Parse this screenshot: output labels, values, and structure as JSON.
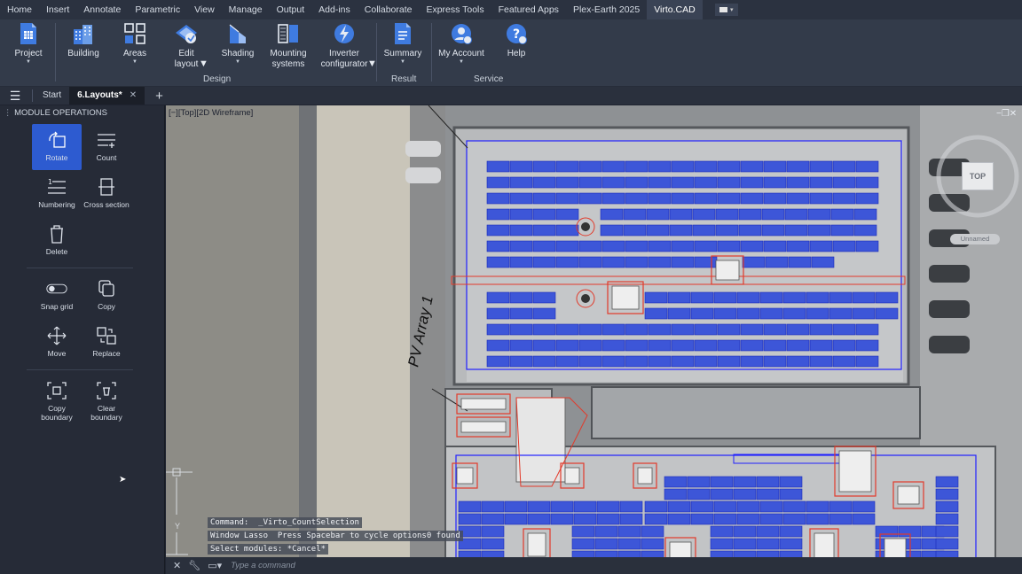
{
  "menubar": {
    "tabs": [
      "Home",
      "Insert",
      "Annotate",
      "Parametric",
      "View",
      "Manage",
      "Output",
      "Add-ins",
      "Collaborate",
      "Express Tools",
      "Featured Apps",
      "Plex-Earth 2025",
      "Virto.CAD"
    ],
    "active": "Virto.CAD"
  },
  "ribbon": {
    "buttons": {
      "project": "Project",
      "building": "Building",
      "areas": "Areas",
      "edit_layout": "Edit\nlayout",
      "shading": "Shading",
      "mounting": "Mounting\nsystems",
      "inverter": "Inverter\nconfigurator",
      "summary": "Summary",
      "my_account": "My Account",
      "help": "Help"
    },
    "groups": {
      "design": "Design",
      "result": "Result",
      "service": "Service"
    }
  },
  "doc_tabs": {
    "start": "Start",
    "layouts": "6.Layouts*"
  },
  "palette": {
    "title": "MODULE OPERATIONS",
    "rotate": "Rotate",
    "count": "Count",
    "numbering": "Numbering",
    "cross_section": "Cross section",
    "delete": "Delete",
    "snap_grid": "Snap grid",
    "copy": "Copy",
    "move": "Move",
    "replace": "Replace",
    "copy_boundary": "Copy\nboundary",
    "clear_boundary": "Clear\nboundary"
  },
  "viewport": {
    "label": "[−][Top][2D Wireframe]",
    "viewcube": "TOP",
    "ucs_name": "Unnamed",
    "array_label": "PV Array 1"
  },
  "command": {
    "history": [
      "Command:  _Virto_CountSelection",
      "Window Lasso  Press Spacebar to cycle options0 found",
      "Select modules: *Cancel*"
    ],
    "placeholder": "Type a command"
  },
  "colors": {
    "accent": "#2d5bd0",
    "module_fill": "#3d56d8",
    "boundary_blue": "#2020ff",
    "obstacle_red": "#e23a2a"
  }
}
